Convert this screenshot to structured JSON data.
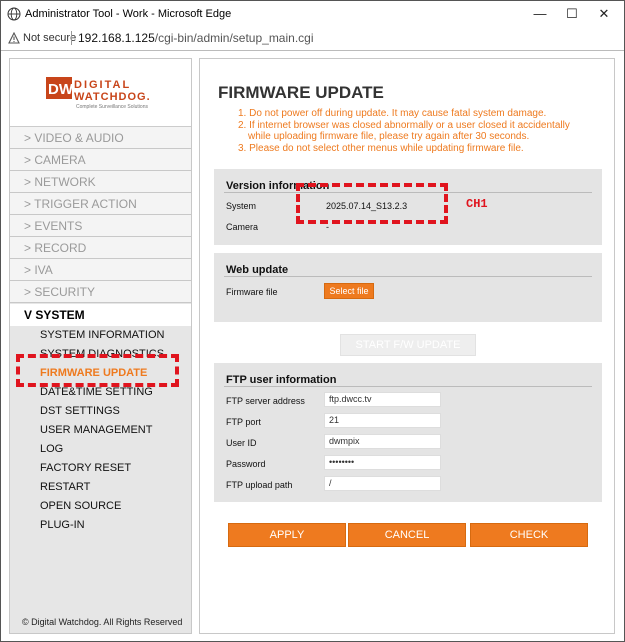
{
  "window": {
    "title": "Administrator Tool - Work - Microsoft Edge"
  },
  "addressbar": {
    "security_label": "Not secure",
    "url_host": "192.168.1.125",
    "url_path": "/cgi-bin/admin/setup_main.cgi"
  },
  "logo": {
    "line1": "DIGITAL",
    "line2": "WATCHDOG.",
    "tagline": "Complete Surveillance Solutions"
  },
  "sidebar": {
    "items": [
      {
        "label": "> VIDEO & AUDIO"
      },
      {
        "label": "> CAMERA"
      },
      {
        "label": "> NETWORK"
      },
      {
        "label": "> TRIGGER ACTION"
      },
      {
        "label": "> EVENTS"
      },
      {
        "label": "> RECORD"
      },
      {
        "label": "> IVA"
      },
      {
        "label": "> SECURITY"
      }
    ],
    "system_label": "V SYSTEM",
    "sub_items": [
      {
        "label": "SYSTEM INFORMATION"
      },
      {
        "label": "SYSTEM DIAGNOSTICS"
      },
      {
        "label": "FIRMWARE UPDATE"
      },
      {
        "label": "DATE&TIME SETTING"
      },
      {
        "label": "DST SETTINGS"
      },
      {
        "label": "USER MANAGEMENT"
      },
      {
        "label": "LOG"
      },
      {
        "label": "FACTORY RESET"
      },
      {
        "label": "RESTART"
      },
      {
        "label": "OPEN SOURCE"
      },
      {
        "label": "PLUG-IN"
      }
    ],
    "footer": "© Digital Watchdog. All Rights Reserved"
  },
  "main": {
    "title": "FIRMWARE UPDATE",
    "warnings": [
      "1. Do not power off during update. It may cause fatal system damage.",
      "2. If internet browser was closed abnormally or a user closed it accidentally",
      "while uploading firmware file, please try again after 30 seconds.",
      "3. Please do not select other menus while updating firmware file."
    ],
    "version": {
      "title": "Version information",
      "system_label": "System",
      "system_value": "2025.07.14_S13.2.3",
      "camera_label": "Camera",
      "camera_value": "-"
    },
    "web_update": {
      "title": "Web update",
      "file_label": "Firmware file",
      "select_button": "Select file"
    },
    "start_button": "START F/W UPDATE",
    "ftp": {
      "title": "FTP user information",
      "fields": [
        {
          "label": "FTP server address",
          "value": "ftp.dwcc.tv"
        },
        {
          "label": "FTP port",
          "value": "21"
        },
        {
          "label": "User ID",
          "value": "dwmpix"
        },
        {
          "label": "Password",
          "value": "••••••••"
        },
        {
          "label": "FTP upload path",
          "value": "/"
        }
      ]
    },
    "buttons": {
      "apply": "APPLY",
      "cancel": "CANCEL",
      "check": "CHECK"
    }
  },
  "annotation": {
    "ch1_label": "CH1",
    "color": "#e0141e"
  },
  "colors": {
    "accent": "#ee7a1f"
  }
}
